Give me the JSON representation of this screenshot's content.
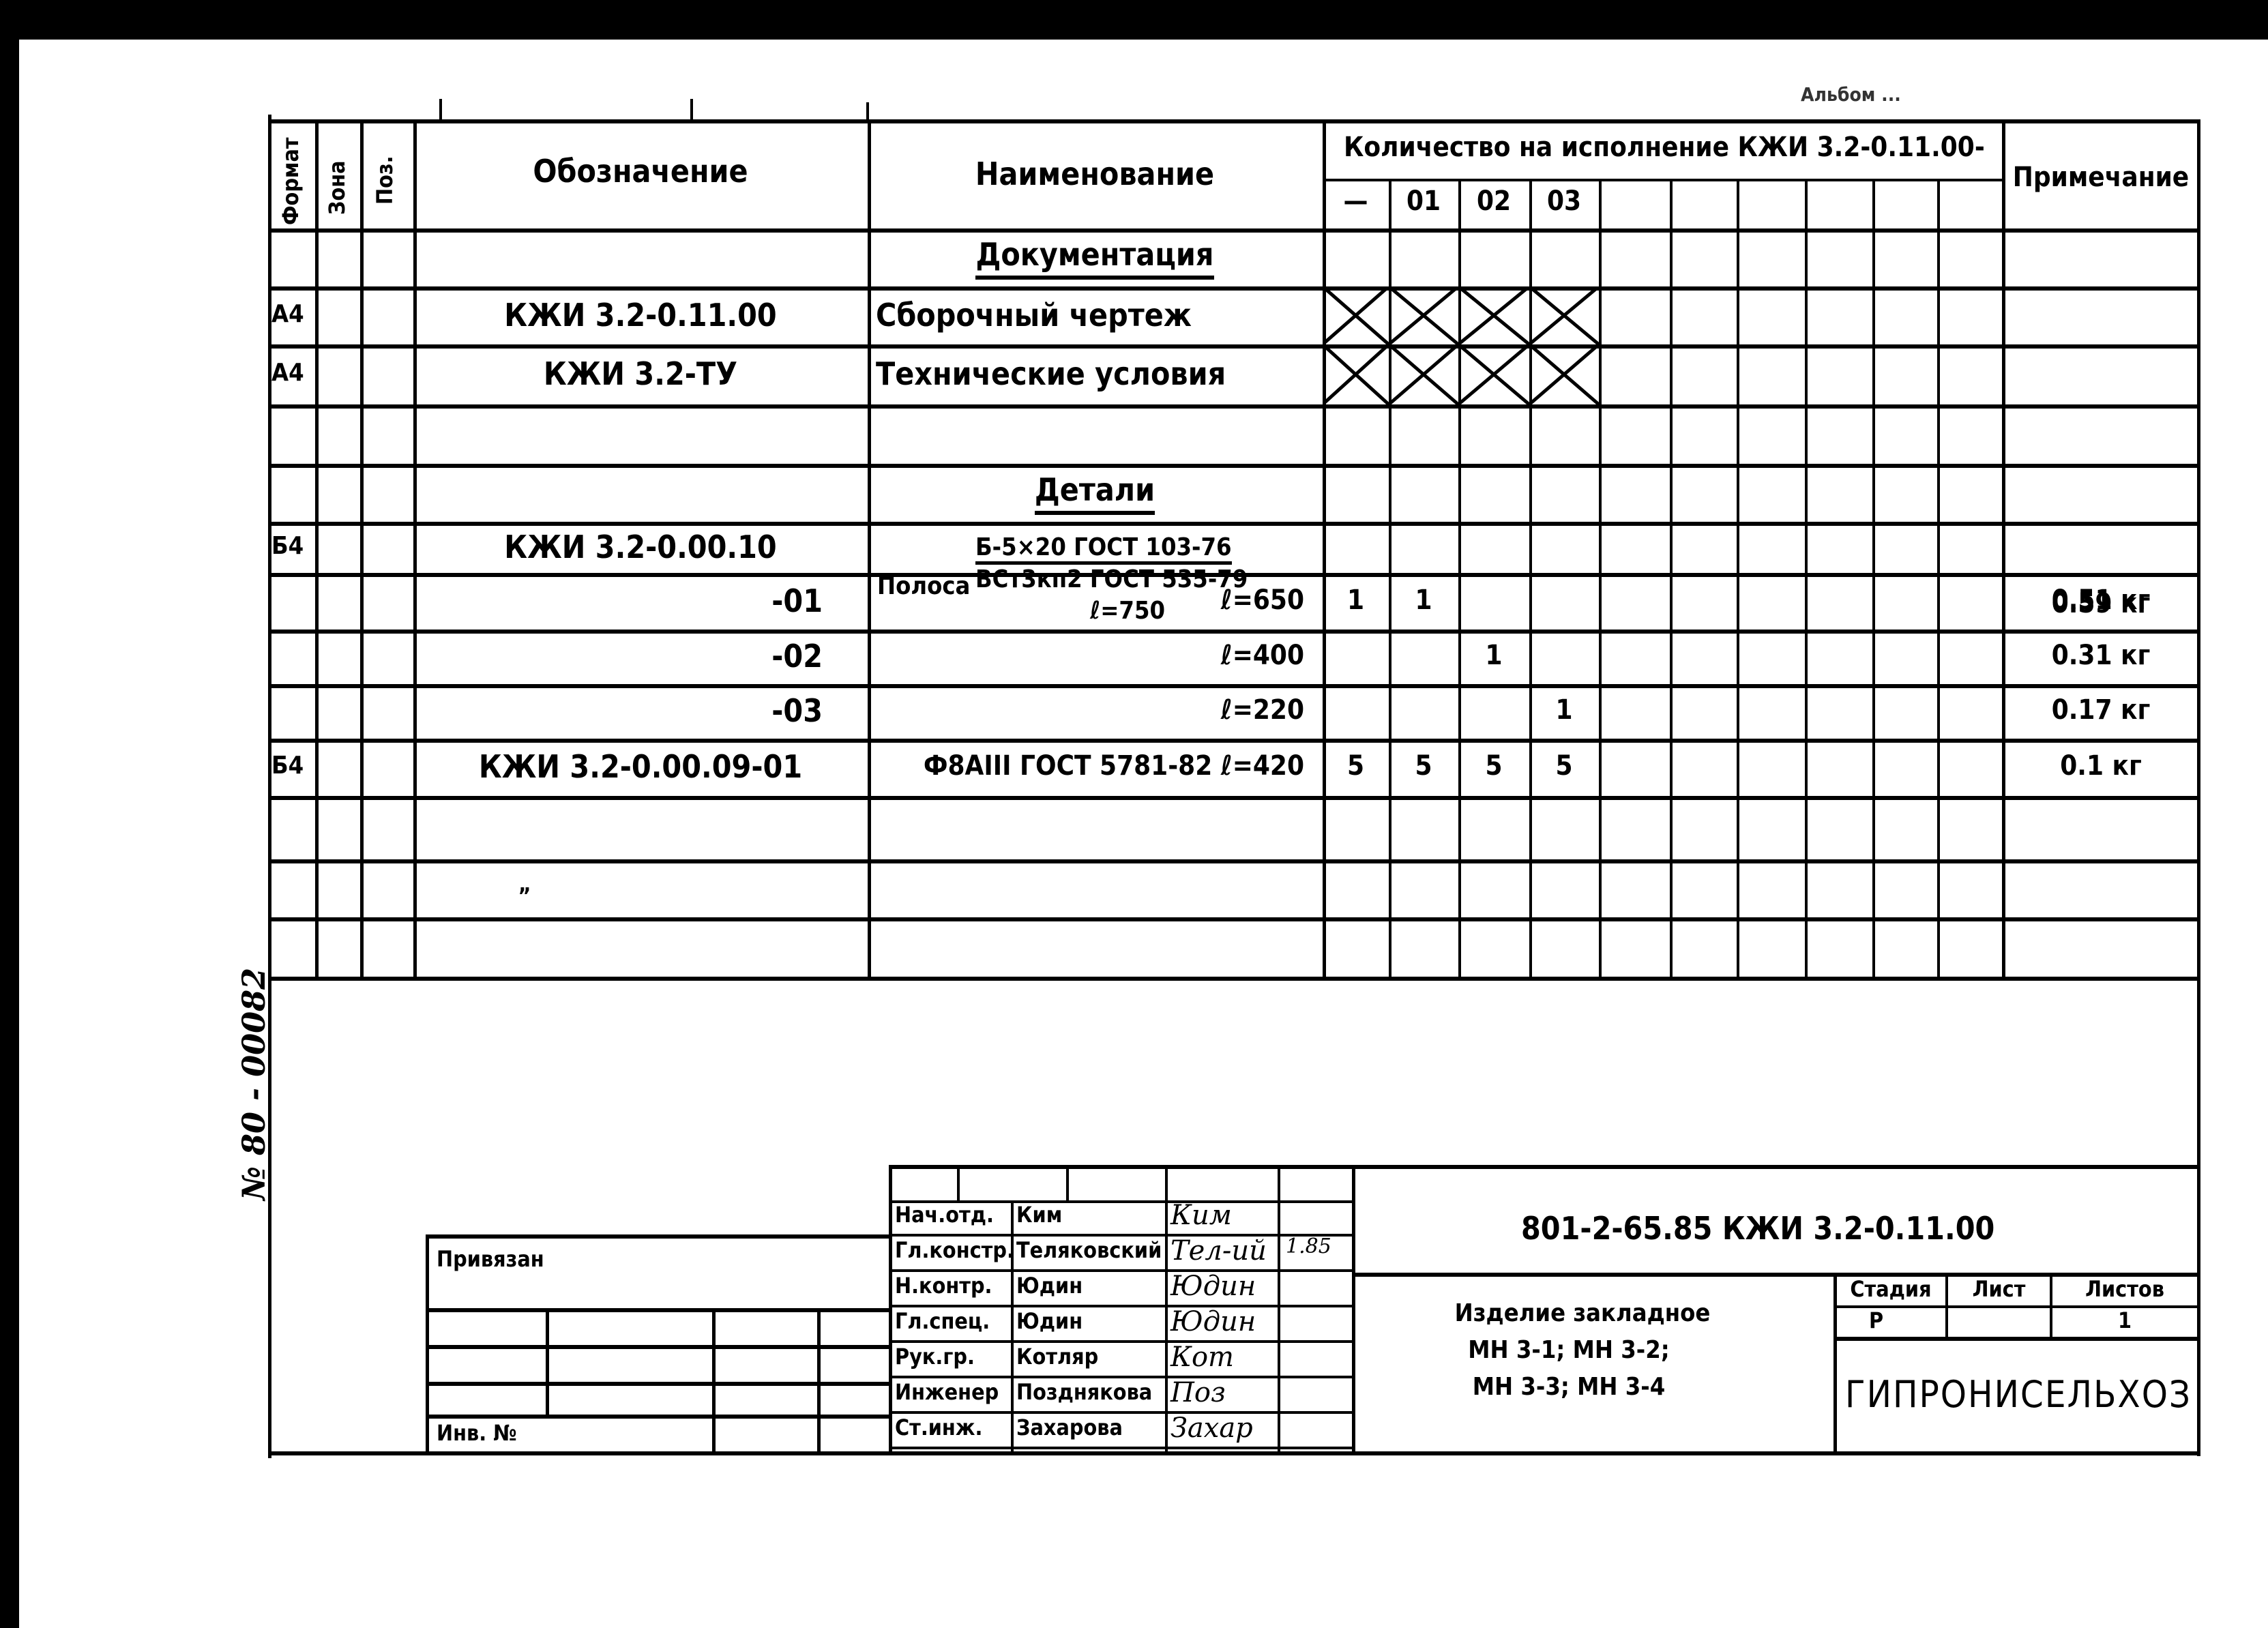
{
  "document": {
    "type": "Спецификация",
    "top_note_faint": "Альбом ...",
    "side_stamp": "№ 80 - 00082"
  },
  "table": {
    "headers": {
      "format": "Формат",
      "zone": "Зона",
      "pos": "Поз.",
      "designation": "Обозначение",
      "name": "Наименование",
      "quantity_group": "Количество на исполнение КЖИ 3.2-0.11.00-",
      "quantity_columns": [
        "—",
        "01",
        "02",
        "03",
        "",
        "",
        "",
        "",
        "",
        ""
      ],
      "note": "Примечание"
    },
    "rows": [
      {
        "kind": "section",
        "name": "Документация"
      },
      {
        "kind": "item",
        "format": "А4",
        "designation": "КЖИ 3.2-0.11.00",
        "name": "Сборочный чертеж",
        "crossed": [
          0,
          1,
          2,
          3
        ],
        "note": ""
      },
      {
        "kind": "item",
        "format": "А4",
        "designation": "КЖИ 3.2-ТУ",
        "name": "Технические условия",
        "crossed": [
          0,
          1,
          2,
          3
        ],
        "note": ""
      },
      {
        "kind": "empty"
      },
      {
        "kind": "section",
        "name": "Детали"
      },
      {
        "kind": "item",
        "format": "Б4",
        "designation": "КЖИ 3.2-0.00.10",
        "name_prefix": "Полоса",
        "name_numerator": "Б-5×20 ГОСТ 103-76",
        "name_denominator": "ВСт3кп2 ГОСТ 535-79",
        "name_length": "ℓ=750",
        "quantities": [
          "1",
          "",
          "",
          ""
        ],
        "note": "0.59 кг"
      },
      {
        "kind": "item",
        "format": "",
        "designation": "-01",
        "name": "ℓ=650",
        "quantities": [
          "",
          "1",
          "",
          ""
        ],
        "note": "0.51 кг"
      },
      {
        "kind": "item",
        "format": "",
        "designation": "-02",
        "name": "ℓ=400",
        "quantities": [
          "",
          "",
          "1",
          ""
        ],
        "note": "0.31 кг"
      },
      {
        "kind": "item",
        "format": "",
        "designation": "-03",
        "name": "ℓ=220",
        "quantities": [
          "",
          "",
          "",
          "1"
        ],
        "note": "0.17 кг"
      },
      {
        "kind": "item",
        "format": "Б4",
        "designation": "КЖИ 3.2-0.00.09-01",
        "name": "Ф8АIII ГОСТ 5781-82  ℓ=420",
        "quantities": [
          "5",
          "5",
          "5",
          "5"
        ],
        "note": "0.1 кг"
      },
      {
        "kind": "empty"
      },
      {
        "kind": "empty",
        "mark": "„"
      }
    ]
  },
  "title_block": {
    "code": "801-2-65.85  КЖИ 3.2-0.11.00",
    "product_name_lines": [
      "Изделие закладное",
      "МН 3-1;  МН 3-2;",
      "МН 3-3;  МН 3-4"
    ],
    "stage_label": "Стадия",
    "sheet_label": "Лист",
    "sheets_label": "Листов",
    "stage_value": "Р",
    "sheet_value": "",
    "sheets_value": "1",
    "organization": "ГИПРОНИСЕЛЬХОЗ",
    "date_note": "1.85",
    "signatures": [
      {
        "role": "Нач.отд.",
        "name": "Ким",
        "signature": "Ким"
      },
      {
        "role": "Гл.констр.",
        "name": "Теляковский",
        "signature": "Тел-ий"
      },
      {
        "role": "Н.контр.",
        "name": "Юдин",
        "signature": "Юдин"
      },
      {
        "role": "Гл.спец.",
        "name": "Юдин",
        "signature": "Юдин"
      },
      {
        "role": "Рук.гр.",
        "name": "Котляр",
        "signature": "Кот"
      },
      {
        "role": "Инженер",
        "name": "Позднякова",
        "signature": "Поз"
      },
      {
        "role": "Ст.инж.",
        "name": "Захарова",
        "signature": "Захар"
      }
    ]
  },
  "binding_block": {
    "label_attached": "Привязан",
    "label_inv": "Инв. №"
  }
}
